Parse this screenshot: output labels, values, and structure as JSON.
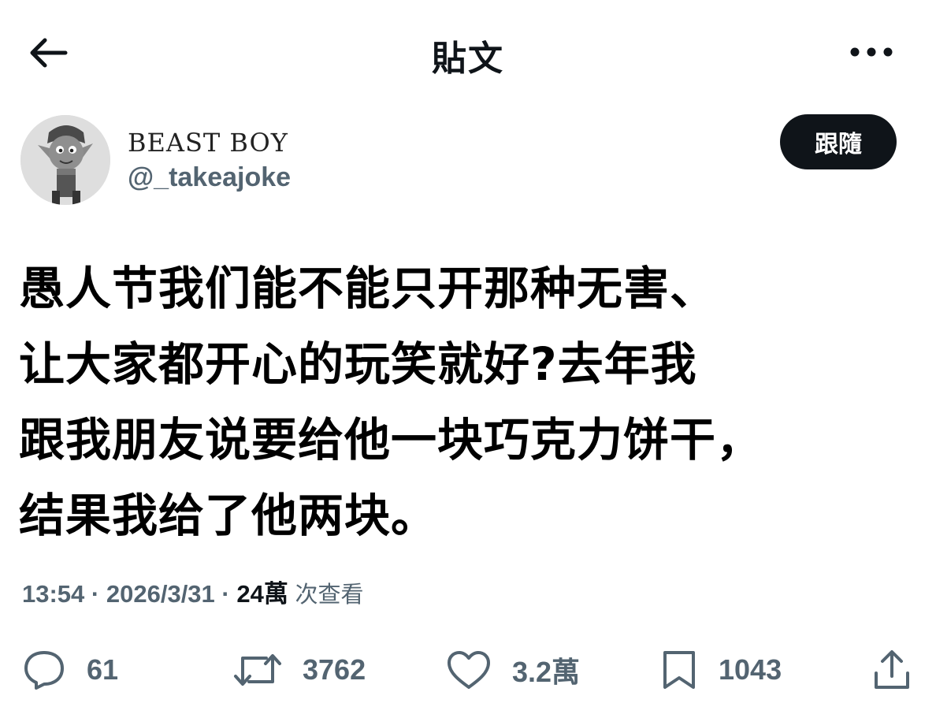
{
  "header": {
    "title": "貼文",
    "back_icon": "arrow-left-icon",
    "more_icon": "more-horizontal-icon"
  },
  "author": {
    "display_name": "BEAST BOY",
    "handle": "@_takeajoke",
    "follow_label": "跟隨"
  },
  "tweet": {
    "text": "愚人节我们能不能只开那种无害、\n让大家都开心的玩笑就好?去年我\n跟我朋友说要给他一块巧克力饼干，\n结果我给了他两块。"
  },
  "meta": {
    "time": "13:54",
    "sep1": "·",
    "date": "2026/3/31",
    "sep2": "·",
    "views_count": "24萬",
    "views_label": "次查看"
  },
  "actions": {
    "replies": "61",
    "retweets": "3762",
    "likes": "3.2萬",
    "bookmarks": "1043"
  },
  "colors": {
    "text": "#0f1419",
    "secondary": "#536471",
    "button_bg": "#0f1419"
  }
}
